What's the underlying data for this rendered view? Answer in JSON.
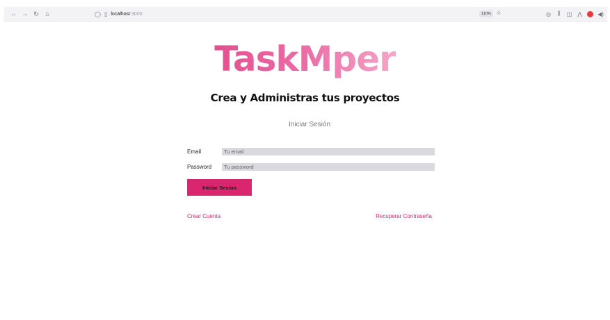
{
  "browser": {
    "url_host": "localhost",
    "url_port": ":3000",
    "zoom": "110%"
  },
  "icons": {
    "back": "back-arrow-icon",
    "forward": "forward-arrow-icon",
    "reload": "reload-icon",
    "home": "home-icon",
    "shield": "shield-icon",
    "page": "page-icon",
    "bookmark": "star-icon",
    "pocket": "pocket-icon",
    "library": "library-icon",
    "sidebar": "sidebar-icon",
    "extensions": [
      "extension-icon",
      "extension-red-icon",
      "speaker-icon"
    ]
  },
  "page": {
    "logo": "TaskMper",
    "subtitle": "Crea y Administras tus proyectos",
    "form_heading": "Iniciar Sesión",
    "email_label": "Email",
    "email_placeholder": "Tu email",
    "password_label": "Password",
    "password_placeholder": "Tu password",
    "submit_label": "Iniciar Sesion",
    "create_account": "Crear Cuenta",
    "recover_password": "Recuperar Contraseña"
  },
  "colors": {
    "accent": "#d9266f",
    "input_bg": "#d9d9de",
    "logo_gradient": [
      "#e3508f",
      "#f3a6c8"
    ]
  }
}
